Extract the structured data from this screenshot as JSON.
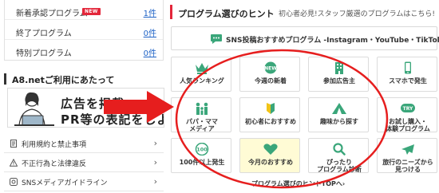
{
  "stats": [
    {
      "label": "新着承認プログラム",
      "badge": "NEW",
      "count": "1件"
    },
    {
      "label": "終了プログラム",
      "badge": "",
      "count": "0件"
    },
    {
      "label": "特別プログラム",
      "badge": "",
      "count": "0件"
    }
  ],
  "a8_section": {
    "title": "A8.netご利用にあたって"
  },
  "banner": {
    "line1": "広告を掲載",
    "line2": "PR等の表記をしよう!"
  },
  "guides": [
    {
      "label": "利用規約と禁止事項",
      "icon": "document-icon"
    },
    {
      "label": "不正行為と法律違反",
      "icon": "warning-icon"
    },
    {
      "label": "SNSメディアガイドライン",
      "icon": "sns-guide-icon"
    }
  ],
  "hint": {
    "title": "プログラム選びのヒント",
    "subtitle": "初心者必見!スタッフ厳選のプログラムはこちら!"
  },
  "sns_button": {
    "label": "SNS投稿おすすめプログラム -Instagram・YouTube・TikTokに-"
  },
  "tiles": [
    {
      "label": "人気ランキング",
      "icon": "crown-icon"
    },
    {
      "label": "今週の新着",
      "icon": "new-icon"
    },
    {
      "label": "参加広告主",
      "icon": "building-icon"
    },
    {
      "label": "スマホで発生",
      "icon": "smartphone-icon"
    },
    {
      "label": "パパ・ママ\nメディア",
      "icon": "family-icon"
    },
    {
      "label": "初心者におすすめ",
      "icon": "beginner-icon"
    },
    {
      "label": "趣味から探す",
      "icon": "tent-icon"
    },
    {
      "label": "お試し購入・\n体験プログラム",
      "icon": "try-icon"
    },
    {
      "label": "100件以上発生",
      "icon": "hundred-icon"
    },
    {
      "label": "今月のおすすめ",
      "icon": "heart-icon"
    },
    {
      "label": "ぴったり\nプログラム診断",
      "icon": "search-icon"
    },
    {
      "label": "旅行のニーズから\n見つける",
      "icon": "plane-icon"
    }
  ],
  "top_link": {
    "label": "プログラム選びのヒントTOPへ",
    "chevron": "›"
  },
  "colors": {
    "accent": "#e3263a",
    "icon_green": "#3aa67a",
    "link": "#1e62c6",
    "highlight": "#fffbd5"
  }
}
